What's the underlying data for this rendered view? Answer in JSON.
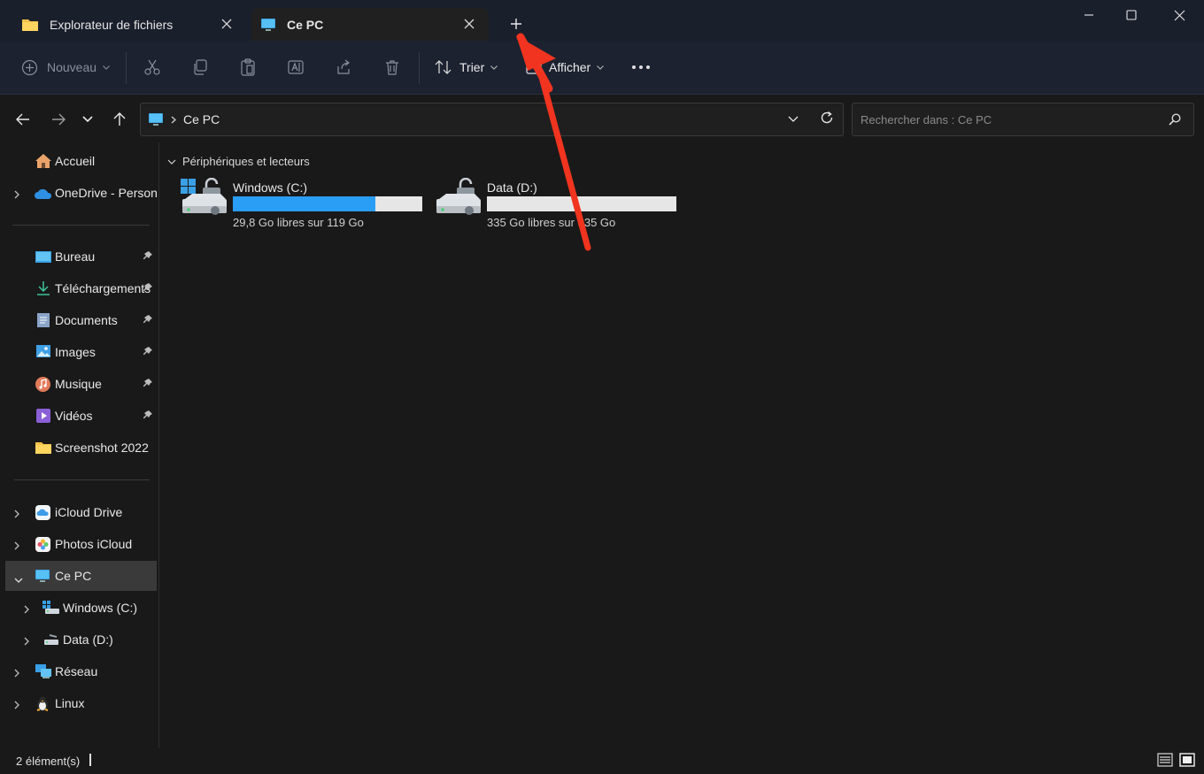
{
  "tabs": [
    {
      "label": "Explorateur de fichiers",
      "icon": "folder-icon"
    },
    {
      "label": "Ce PC",
      "icon": "monitor-icon",
      "active": true
    }
  ],
  "toolbar": {
    "new_label": "Nouveau",
    "sort_label": "Trier",
    "view_label": "Afficher"
  },
  "address": {
    "path": "Ce PC"
  },
  "search": {
    "placeholder": "Rechercher dans : Ce PC"
  },
  "sidebar": {
    "items": [
      {
        "label": "Accueil",
        "icon": "home-icon"
      },
      {
        "label": "OneDrive - Persona",
        "icon": "onedrive-icon"
      },
      {
        "label": "Bureau",
        "icon": "desktop-icon",
        "pinned": true
      },
      {
        "label": "Téléchargements",
        "icon": "download-icon",
        "pinned": true
      },
      {
        "label": "Documents",
        "icon": "documents-icon",
        "pinned": true
      },
      {
        "label": "Images",
        "icon": "images-icon",
        "pinned": true
      },
      {
        "label": "Musique",
        "icon": "music-icon",
        "pinned": true
      },
      {
        "label": "Vidéos",
        "icon": "videos-icon",
        "pinned": true
      },
      {
        "label": "Screenshot 2022",
        "icon": "folder-icon"
      },
      {
        "label": "iCloud Drive",
        "icon": "icloud-icon"
      },
      {
        "label": "Photos iCloud",
        "icon": "icloud-photos-icon"
      },
      {
        "label": "Ce PC",
        "icon": "monitor-icon",
        "selected": true
      },
      {
        "label": "Windows (C:)",
        "icon": "drive-c-icon"
      },
      {
        "label": "Data (D:)",
        "icon": "drive-d-icon"
      },
      {
        "label": "Réseau",
        "icon": "network-icon"
      },
      {
        "label": "Linux",
        "icon": "linux-icon"
      }
    ]
  },
  "content": {
    "group_label": "Périphériques et lecteurs",
    "drives": [
      {
        "name": "Windows (C:)",
        "free_text": "29,8 Go libres sur 119 Go",
        "used_fraction": 0.75
      },
      {
        "name": "Data (D:)",
        "free_text": "335 Go libres sur 335 Go",
        "used_fraction": 0.0
      }
    ]
  },
  "status": {
    "count_text": "2 élément(s)"
  },
  "colors": {
    "accent": "#2a9df4",
    "annotation": "#f0341f"
  }
}
